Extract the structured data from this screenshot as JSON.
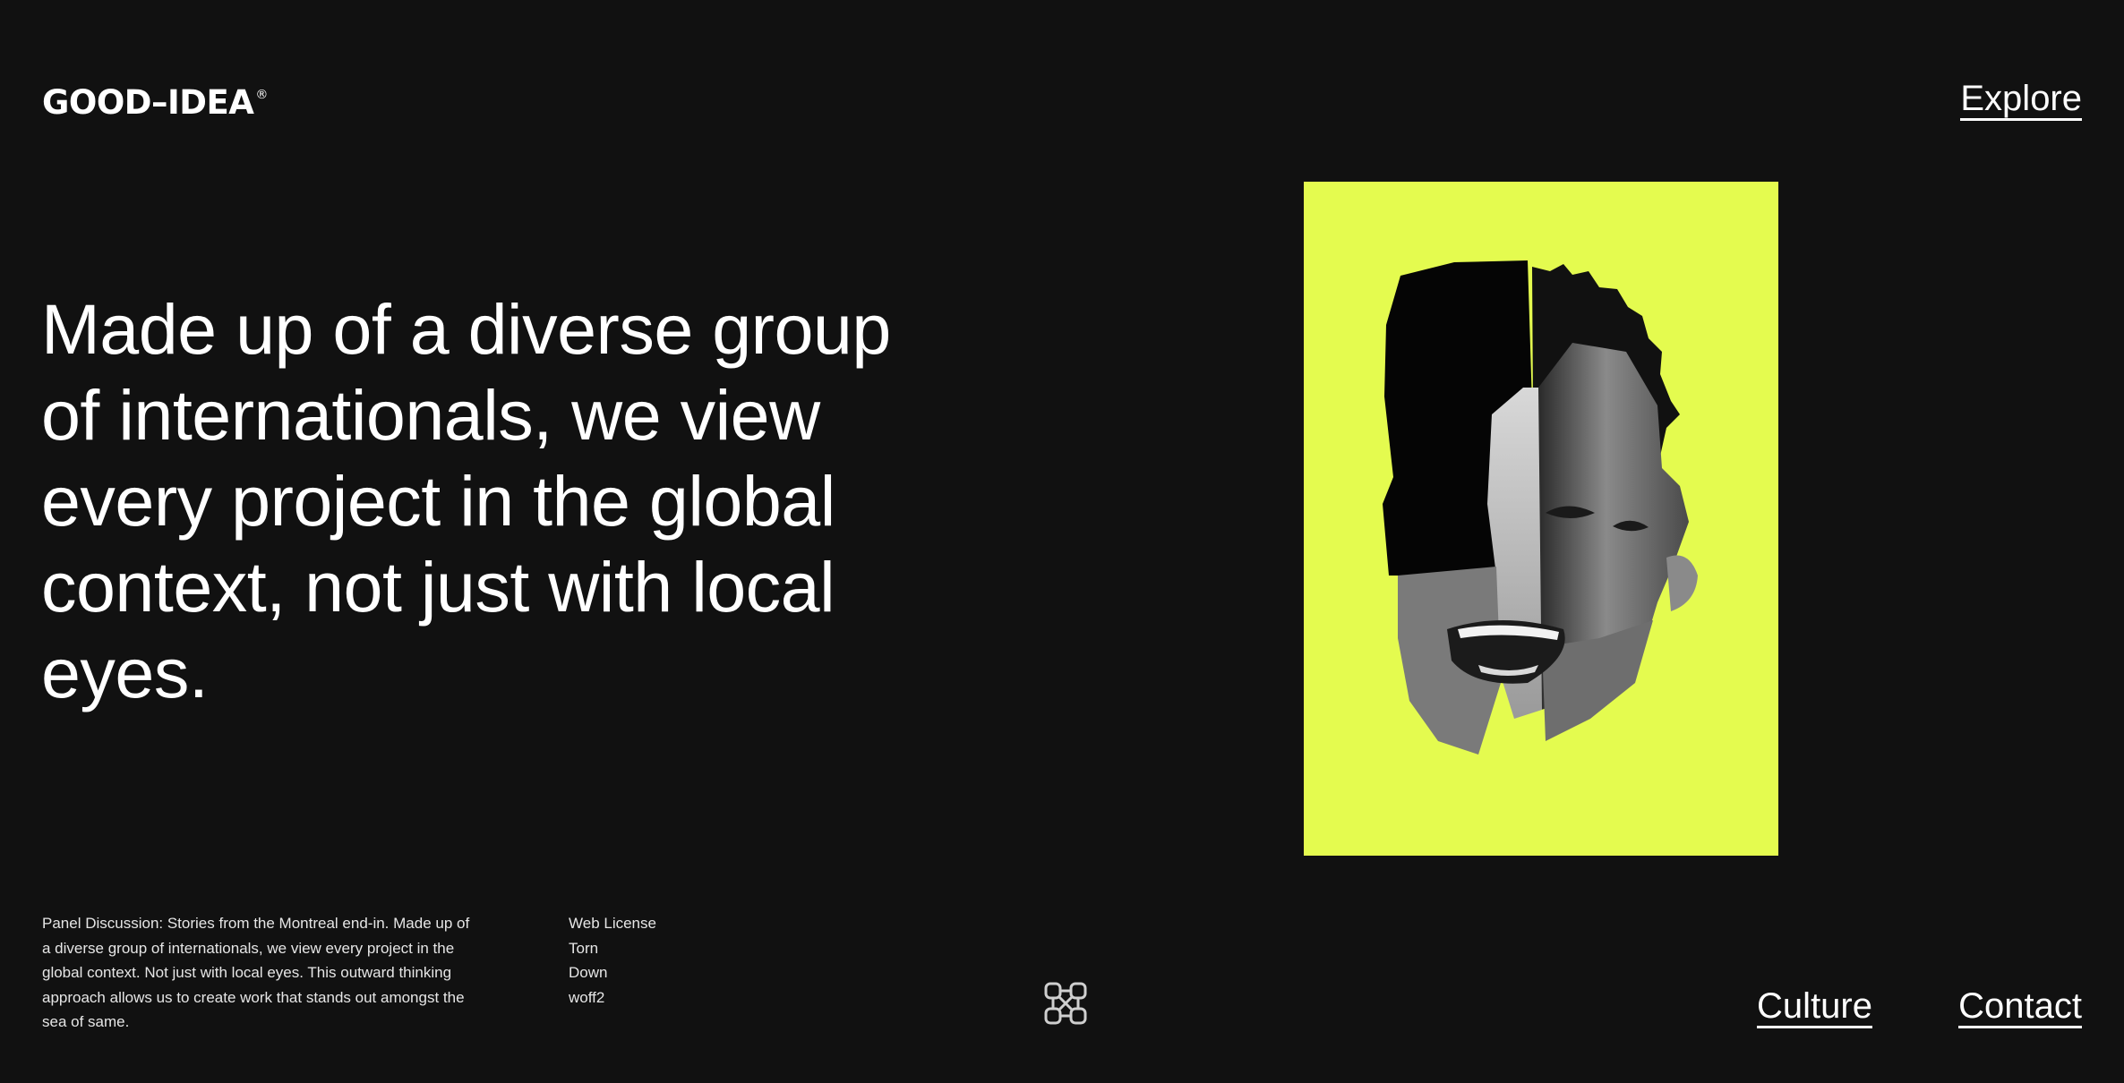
{
  "header": {
    "logo_text": "GOOD–IDEA",
    "logo_mark": "®",
    "nav_explore": "Explore"
  },
  "hero": {
    "headline": "Made up of a diverse group of internationals, we view every project in the global context, not just with local eyes.",
    "image": {
      "description_icon": "collage-face-image",
      "background_color": "#e4fb4f"
    }
  },
  "footer": {
    "description": "Panel Discussion: Stories from the Montreal end-in. Made up of a diverse group of internationals, we view every project in the global context.  Not just with local eyes. This outward thinking approach allows us to create work that stands out amongst the sea of same.",
    "meta": [
      "Web License",
      "Torn",
      "Down",
      "woff2"
    ],
    "center_icon": "celtic-knot-icon",
    "nav_culture": "Culture",
    "nav_contact": "Contact"
  },
  "colors": {
    "background": "#111111",
    "text": "#ffffff",
    "accent": "#e4fb4f"
  }
}
